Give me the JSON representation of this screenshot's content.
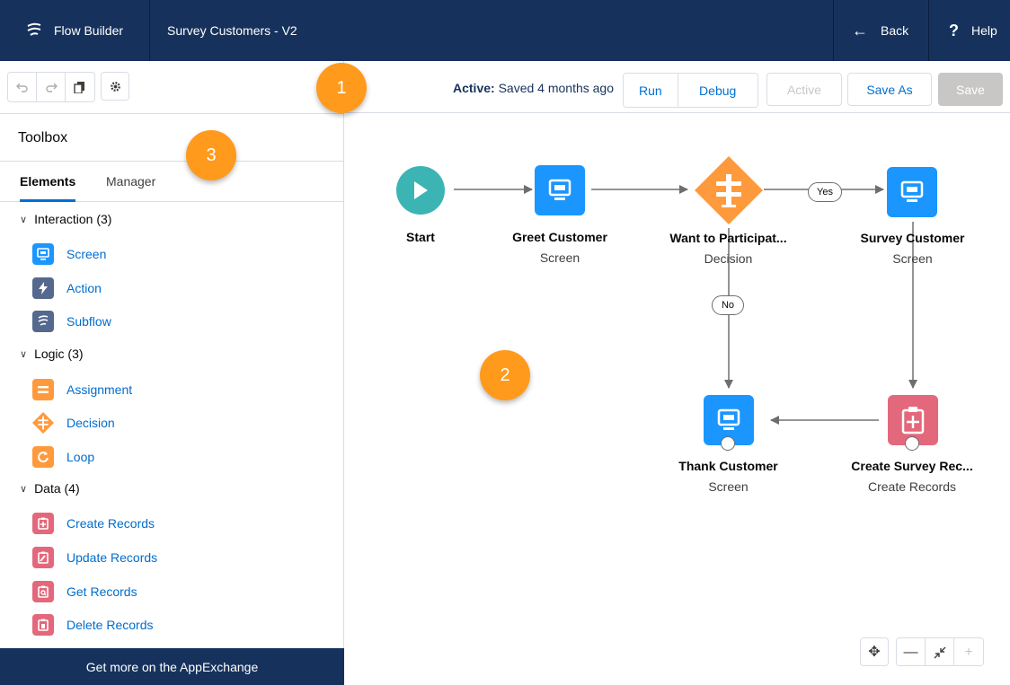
{
  "topbar": {
    "app_name": "Flow Builder",
    "flow_name": "Survey Customers - V2",
    "back_label": "Back",
    "help_label": "Help"
  },
  "sidebar": {
    "title": "Toolbox",
    "tabs": [
      "Elements",
      "Manager"
    ],
    "active_tab": "Elements",
    "sections": [
      {
        "label": "Interaction (3)",
        "items": [
          {
            "label": "Screen",
            "icon": "screen-icon"
          },
          {
            "label": "Action",
            "icon": "lightning-icon"
          },
          {
            "label": "Subflow",
            "icon": "subflow-icon"
          }
        ]
      },
      {
        "label": "Logic (3)",
        "items": [
          {
            "label": "Assignment",
            "icon": "assignment-icon"
          },
          {
            "label": "Decision",
            "icon": "decision-icon"
          },
          {
            "label": "Loop",
            "icon": "loop-icon"
          }
        ]
      },
      {
        "label": "Data (4)",
        "items": [
          {
            "label": "Create Records",
            "icon": "create-records-icon"
          },
          {
            "label": "Update Records",
            "icon": "update-records-icon"
          },
          {
            "label": "Get Records",
            "icon": "get-records-icon"
          },
          {
            "label": "Delete Records",
            "icon": "delete-records-icon"
          }
        ]
      }
    ],
    "appexchange_label": "Get more on the AppExchange"
  },
  "actionbar": {
    "status_prefix": "Active:",
    "status_text": "Saved 4 months ago",
    "buttons": {
      "run": "Run",
      "debug": "Debug",
      "active": "Active",
      "save_as": "Save As",
      "save": "Save"
    }
  },
  "canvas": {
    "nodes": {
      "start": {
        "label": "Start",
        "sub": ""
      },
      "greet": {
        "label": "Greet Customer",
        "sub": "Screen"
      },
      "decision": {
        "label": "Want to Participat...",
        "sub": "Decision"
      },
      "survey": {
        "label": "Survey Customer",
        "sub": "Screen"
      },
      "thank": {
        "label": "Thank Customer",
        "sub": "Screen"
      },
      "create": {
        "label": "Create Survey Rec...",
        "sub": "Create Records"
      }
    },
    "connectors": {
      "yes": "Yes",
      "no": "No"
    }
  },
  "callouts": [
    "1",
    "2",
    "3"
  ],
  "colors": {
    "navy": "#16325c",
    "screen_blue": "#1b96ff",
    "start_teal": "#3cb4b4",
    "decision_orange": "#ff9a3c",
    "records_pink": "#e3687c",
    "callout_orange": "#ff9a1c",
    "link_blue": "#006dcc"
  }
}
